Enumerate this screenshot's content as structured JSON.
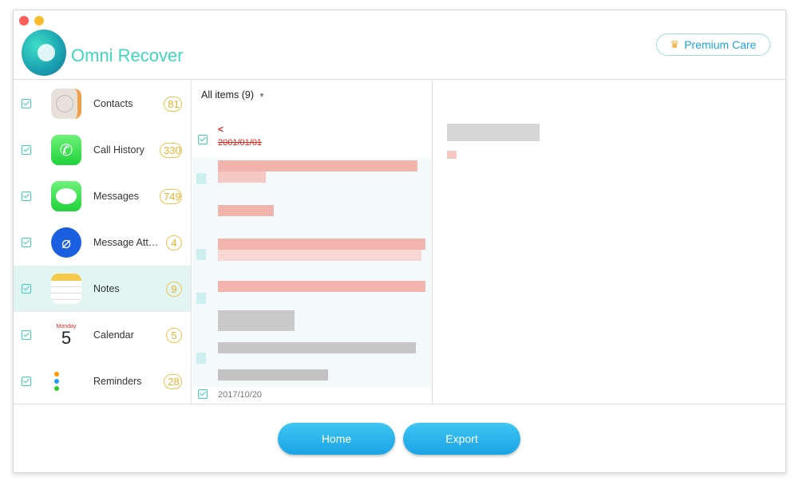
{
  "app": {
    "name": "Omni Recover",
    "premium_label": "Premium Care",
    "premium_icon": "crown-icon"
  },
  "sidebar": {
    "items": [
      {
        "label": "Contacts",
        "count": "81",
        "icon": "contacts-icon"
      },
      {
        "label": "Call History",
        "count": "330",
        "icon": "phone-icon"
      },
      {
        "label": "Messages",
        "count": "749",
        "icon": "messages-icon"
      },
      {
        "label": "Message Att…",
        "count": "4",
        "icon": "attachment-icon"
      },
      {
        "label": "Notes",
        "count": "9",
        "icon": "notes-icon",
        "selected": true
      },
      {
        "label": "Calendar",
        "count": "5",
        "icon": "calendar-icon",
        "calendar_month": "Monday",
        "calendar_day": "5"
      },
      {
        "label": "Reminders",
        "count": "28",
        "icon": "reminders-icon"
      }
    ]
  },
  "list": {
    "filter_label": "All items (9)",
    "first_item": {
      "title": "<",
      "date": "2001/01/01"
    },
    "last_item_date": "2017/10/20"
  },
  "footer": {
    "home_label": "Home",
    "export_label": "Export"
  },
  "colors": {
    "accent": "#3dd9bf",
    "badge": "#f1c24a",
    "button": "#1fa6dc",
    "deleted": "#e8231b"
  }
}
